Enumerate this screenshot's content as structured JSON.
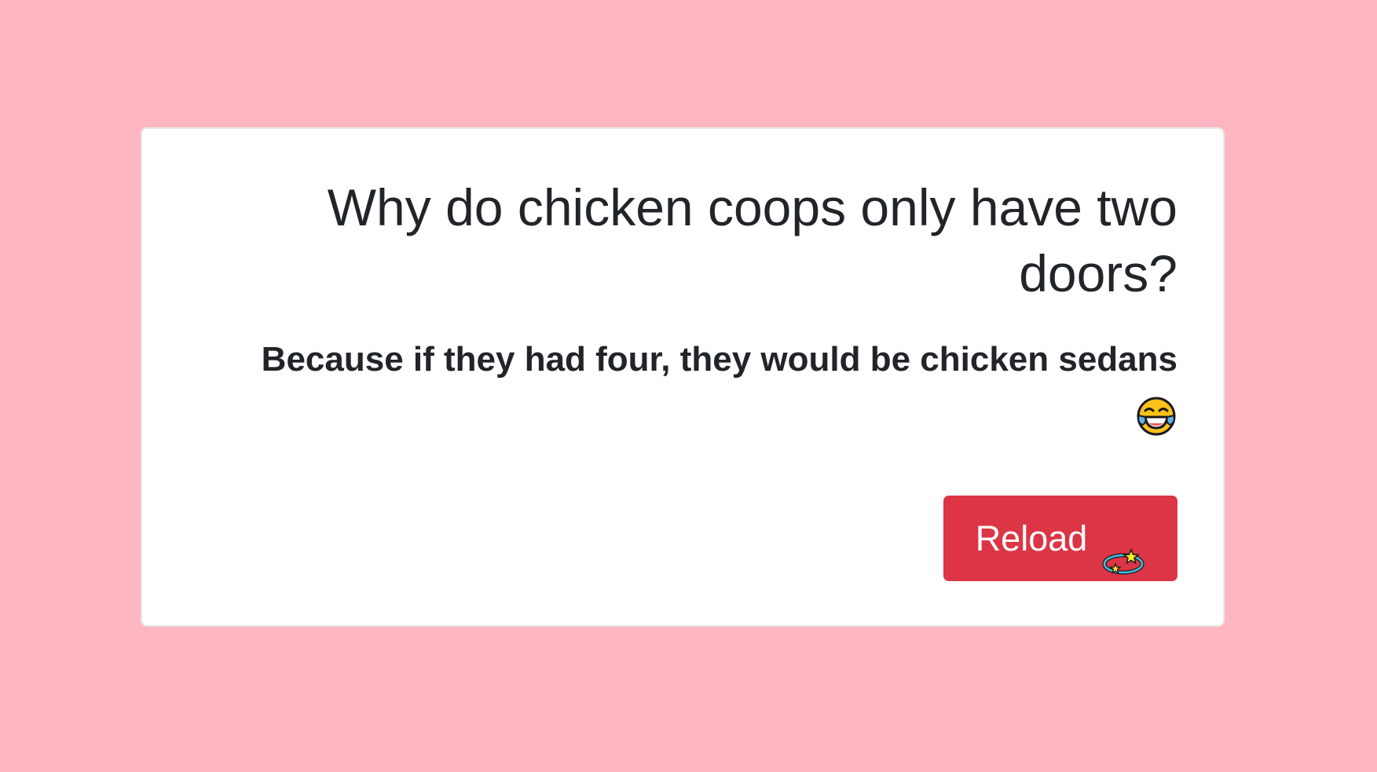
{
  "joke": {
    "question": "Why do chicken coops only have two doors?",
    "answer": "Because if they had four, they would be chicken sedans",
    "answer_emoji": "face-with-tears-of-joy-icon"
  },
  "reload_button": {
    "label": "Reload",
    "icon": "dizzy-icon",
    "color": "#dc3545"
  },
  "colors": {
    "background": "#ffb6c1",
    "card": "#ffffff",
    "text": "#212529"
  }
}
